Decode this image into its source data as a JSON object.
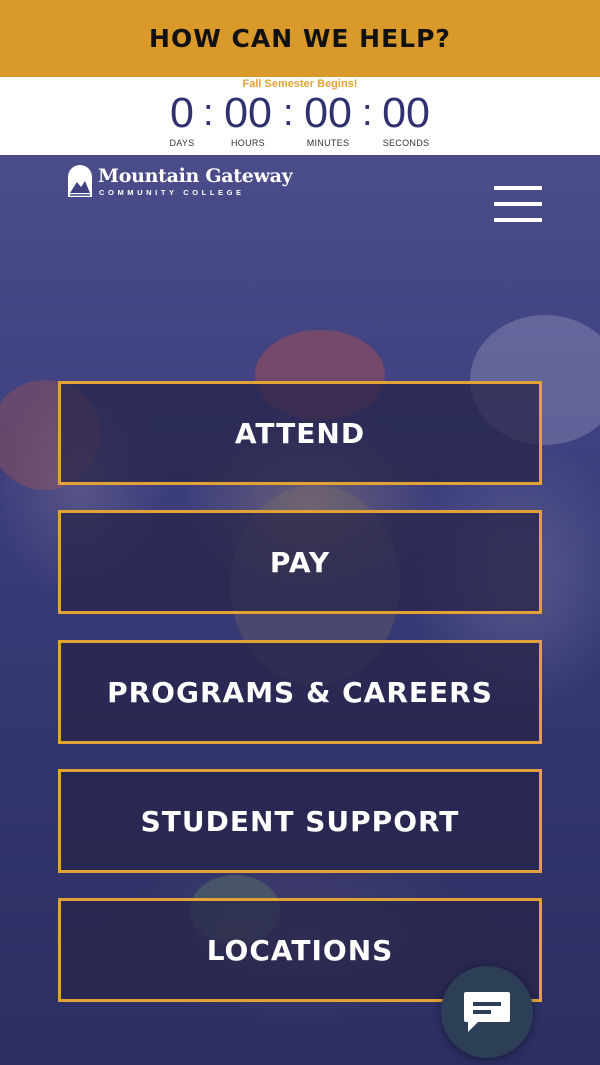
{
  "banner": {
    "label": "HOW CAN WE HELP?"
  },
  "countdown": {
    "caption": "Fall Semester Begins!",
    "units": [
      {
        "value": "0",
        "label": "DAYS"
      },
      {
        "value": "00",
        "label": "HOURS"
      },
      {
        "value": "00",
        "label": "MINUTES"
      },
      {
        "value": "00",
        "label": "SECONDS"
      }
    ],
    "separator": ":"
  },
  "logo": {
    "name": "Mountain Gateway",
    "subtitle": "COMMUNITY COLLEGE"
  },
  "nav": {
    "items": [
      {
        "label": "ATTEND"
      },
      {
        "label": "PAY"
      },
      {
        "label": "PROGRAMS & CAREERS"
      },
      {
        "label": "STUDENT SUPPORT"
      },
      {
        "label": "LOCATIONS"
      }
    ]
  },
  "colors": {
    "accent": "#d99a2b",
    "navy": "#2f3170",
    "button_border": "#e2a236"
  },
  "icons": {
    "menu": "hamburger-icon",
    "chat": "chat-bubble-icon",
    "logo": "mountain-logo-icon"
  }
}
